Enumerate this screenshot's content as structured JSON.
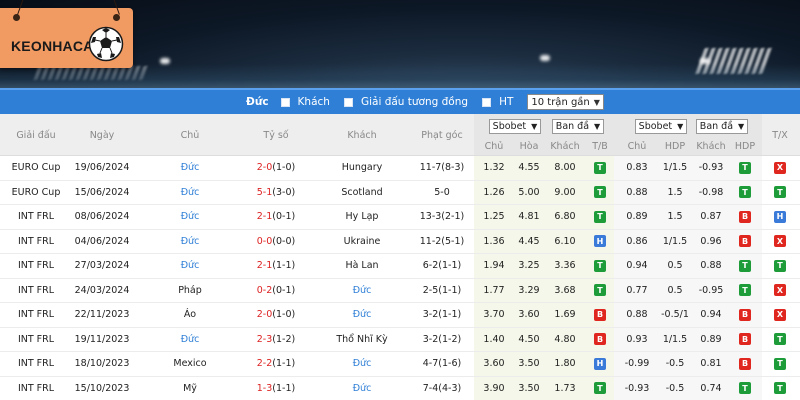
{
  "logo": {
    "text": "KEONHACAI"
  },
  "filter": {
    "team": "Đức",
    "options": [
      "Khách",
      "Giải đấu tương đồng",
      "HT"
    ],
    "select": "10 trận gần"
  },
  "headers": {
    "league": "Giải đấu",
    "date": "Ngày",
    "home": "Chủ",
    "score": "Tỷ số",
    "away": "Khách",
    "corner": "Phạt góc",
    "bookmaker1": "Sbobet",
    "bettype1": "Ban đầ",
    "bookmaker2": "Sbobet",
    "bettype2": "Ban đầ",
    "sub1": [
      "Chủ",
      "Hòa",
      "Khách",
      "T/B"
    ],
    "sub2": [
      "Chủ",
      "HDP",
      "Khách",
      "HDP"
    ],
    "result": "T/X"
  },
  "colors": {
    "green": "#1f9c3a",
    "red": "#e0271f",
    "blue": "#3a7ad8",
    "filterbar": "#2f7fd6"
  },
  "rows": [
    {
      "league": "EURO Cup",
      "date": "19/06/2024",
      "home": "Đức",
      "score": "2-0",
      "ht": "(1-0)",
      "away": "Hungary",
      "corner": "11-7(8-3)",
      "o1": "1.32",
      "o2": "4.55",
      "o3": "8.00",
      "tb": "T",
      "h1": "0.83",
      "hdp": "1/1.5",
      "h2": "-0.93",
      "hr": "T",
      "tx": "X"
    },
    {
      "league": "EURO Cup",
      "date": "15/06/2024",
      "home": "Đức",
      "score": "5-1",
      "ht": "(3-0)",
      "away": "Scotland",
      "corner": "5-0",
      "o1": "1.26",
      "o2": "5.00",
      "o3": "9.00",
      "tb": "T",
      "h1": "0.88",
      "hdp": "1.5",
      "h2": "-0.98",
      "hr": "T",
      "tx": "T"
    },
    {
      "league": "INT FRL",
      "date": "08/06/2024",
      "home": "Đức",
      "score": "2-1",
      "ht": "(0-1)",
      "away": "Hy Lạp",
      "corner": "13-3(2-1)",
      "o1": "1.25",
      "o2": "4.81",
      "o3": "6.80",
      "tb": "T",
      "h1": "0.89",
      "hdp": "1.5",
      "h2": "0.87",
      "hr": "B",
      "tx": "H"
    },
    {
      "league": "INT FRL",
      "date": "04/06/2024",
      "home": "Đức",
      "score": "0-0",
      "ht": "(0-0)",
      "away": "Ukraine",
      "corner": "11-2(5-1)",
      "o1": "1.36",
      "o2": "4.45",
      "o3": "6.10",
      "tb": "H",
      "h1": "0.86",
      "hdp": "1/1.5",
      "h2": "0.96",
      "hr": "B",
      "tx": "X"
    },
    {
      "league": "INT FRL",
      "date": "27/03/2024",
      "home": "Đức",
      "score": "2-1",
      "ht": "(1-1)",
      "away": "Hà Lan",
      "corner": "6-2(1-1)",
      "o1": "1.94",
      "o2": "3.25",
      "o3": "3.36",
      "tb": "T",
      "h1": "0.94",
      "hdp": "0.5",
      "h2": "0.88",
      "hr": "T",
      "tx": "T"
    },
    {
      "league": "INT FRL",
      "date": "24/03/2024",
      "home": "Pháp",
      "score": "0-2",
      "ht": "(0-1)",
      "away": "Đức",
      "corner": "2-5(1-1)",
      "o1": "1.77",
      "o2": "3.29",
      "o3": "3.68",
      "tb": "T",
      "h1": "0.77",
      "hdp": "0.5",
      "h2": "-0.95",
      "hr": "T",
      "tx": "X"
    },
    {
      "league": "INT FRL",
      "date": "22/11/2023",
      "home": "Áo",
      "score": "2-0",
      "ht": "(1-0)",
      "away": "Đức",
      "corner": "3-2(1-1)",
      "o1": "3.70",
      "o2": "3.60",
      "o3": "1.69",
      "tb": "B",
      "h1": "0.88",
      "hdp": "-0.5/1",
      "h2": "0.94",
      "hr": "B",
      "tx": "X"
    },
    {
      "league": "INT FRL",
      "date": "19/11/2023",
      "home": "Đức",
      "score": "2-3",
      "ht": "(1-2)",
      "away": "Thổ Nhĩ Kỳ",
      "corner": "3-2(1-2)",
      "o1": "1.40",
      "o2": "4.50",
      "o3": "4.80",
      "tb": "B",
      "h1": "0.93",
      "hdp": "1/1.5",
      "h2": "0.89",
      "hr": "B",
      "tx": "T"
    },
    {
      "league": "INT FRL",
      "date": "18/10/2023",
      "home": "Mexico",
      "score": "2-2",
      "ht": "(1-1)",
      "away": "Đức",
      "corner": "4-7(1-6)",
      "o1": "3.60",
      "o2": "3.50",
      "o3": "1.80",
      "tb": "H",
      "h1": "-0.99",
      "hdp": "-0.5",
      "h2": "0.81",
      "hr": "B",
      "tx": "T"
    },
    {
      "league": "INT FRL",
      "date": "15/10/2023",
      "home": "Mỹ",
      "score": "1-3",
      "ht": "(1-1)",
      "away": "Đức",
      "corner": "7-4(4-3)",
      "o1": "3.90",
      "o2": "3.50",
      "o3": "1.73",
      "tb": "T",
      "h1": "-0.93",
      "hdp": "-0.5",
      "h2": "0.74",
      "hr": "T",
      "tx": "T"
    }
  ]
}
